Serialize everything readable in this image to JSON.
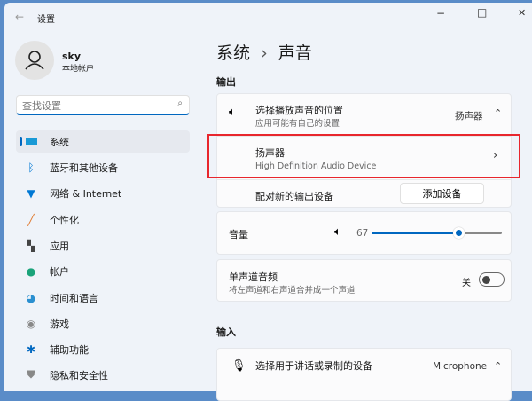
{
  "window": {
    "title": "设置",
    "minimize": "−",
    "maximize": "□",
    "close": "✕"
  },
  "user": {
    "name": "sky",
    "type": "本地帐户"
  },
  "search": {
    "placeholder": "查找设置"
  },
  "nav": [
    {
      "label": "系统",
      "icon": "monitor-icon"
    },
    {
      "label": "蓝牙和其他设备",
      "icon": "bluetooth-icon"
    },
    {
      "label": "网络 & Internet",
      "icon": "wifi-icon"
    },
    {
      "label": "个性化",
      "icon": "brush-icon"
    },
    {
      "label": "应用",
      "icon": "apps-icon"
    },
    {
      "label": "帐户",
      "icon": "account-icon"
    },
    {
      "label": "时间和语言",
      "icon": "globe-clock-icon"
    },
    {
      "label": "游戏",
      "icon": "gamepad-icon"
    },
    {
      "label": "辅助功能",
      "icon": "accessibility-icon"
    },
    {
      "label": "隐私和安全性",
      "icon": "shield-icon"
    }
  ],
  "breadcrumb": {
    "parent": "系统",
    "sep": "›",
    "current": "声音"
  },
  "output": {
    "section": "输出",
    "choose_title": "选择播放声音的位置",
    "choose_sub": "应用可能有自己的设置",
    "choose_value": "扬声器",
    "device_name": "扬声器",
    "device_desc": "High Definition Audio Device",
    "pair_label": "配对新的输出设备",
    "add_button": "添加设备"
  },
  "volume": {
    "label": "音量",
    "value": "67",
    "fraction": 0.67
  },
  "mono": {
    "title": "单声道音频",
    "sub": "将左声道和右声道合并成一个声道",
    "state": "关"
  },
  "input": {
    "section": "输入",
    "choose_title": "选择用于讲话或录制的设备",
    "choose_value": "Microphone"
  },
  "colors": {
    "accent": "#0067c0",
    "highlight": "#e81123"
  }
}
